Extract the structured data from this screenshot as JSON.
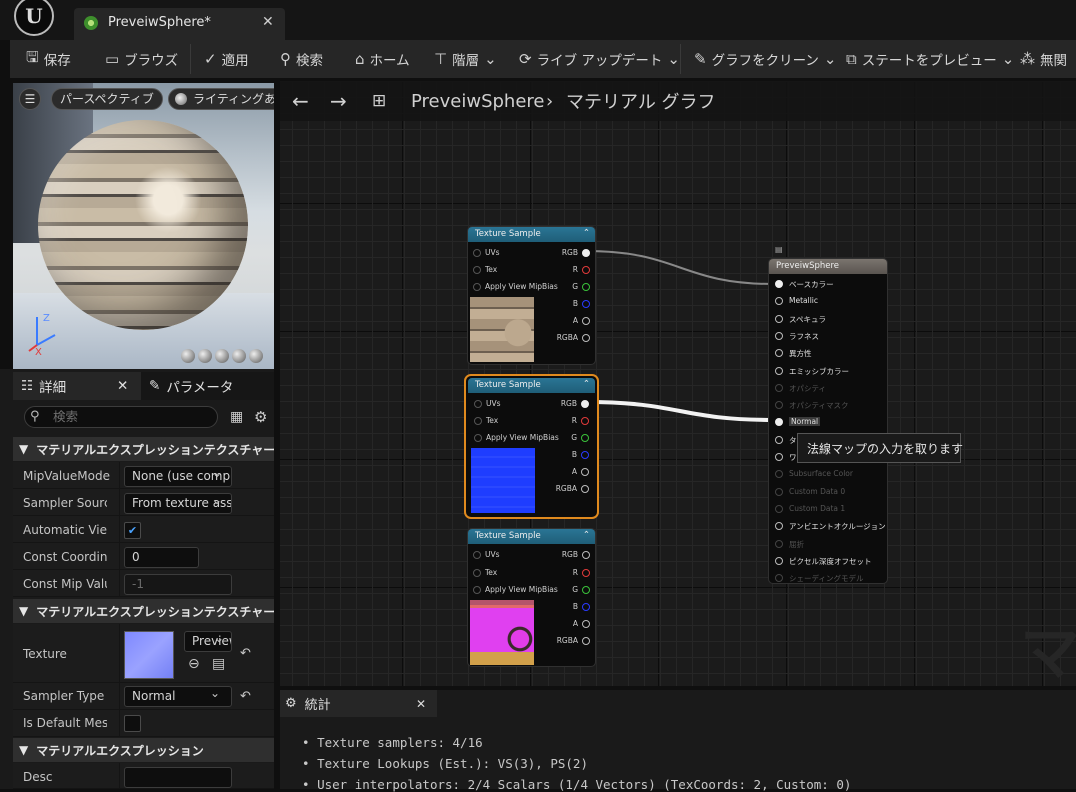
{
  "window": {
    "tab_title": "PreveiwSphere*",
    "close_glyph": "✕"
  },
  "toolbar": {
    "items": [
      {
        "icon": "save-icon",
        "label": "保存"
      },
      {
        "icon": "browse-icon",
        "label": "ブラウズ"
      },
      {
        "icon": "apply-icon",
        "label": "適用"
      },
      {
        "icon": "search-icon",
        "label": "検索"
      },
      {
        "icon": "home-icon",
        "label": "ホーム"
      },
      {
        "icon": "hierarchy-icon",
        "label": "階層"
      },
      {
        "icon": "live-update-icon",
        "label": "ライブ アップデート"
      },
      {
        "icon": "clean-graph-icon",
        "label": "グラフをクリーン"
      },
      {
        "icon": "state-preview-icon",
        "label": "ステートをプレビュー"
      },
      {
        "icon": "hide-unrelated-icon",
        "label": "無関"
      }
    ]
  },
  "viewport": {
    "perspective": "パースペクティブ",
    "lighting": "ライティングあり",
    "axis_z": "Z",
    "axis_x": "X"
  },
  "details": {
    "tabs": [
      {
        "label": "詳細"
      },
      {
        "label": "パラメータ"
      }
    ],
    "search_placeholder": "検索",
    "categories": [
      "マテリアルエクスプレッションテクスチャーサンプル",
      "マテリアルエクスプレッションテクスチャーベース",
      "マテリアルエクスプレッション"
    ],
    "rows": [
      {
        "label": "MipValueMode",
        "value": "None (use computed mip)"
      },
      {
        "label": "Sampler Source",
        "value": "From texture asset"
      },
      {
        "label": "Automatic View Mip Bias",
        "value": "✔"
      },
      {
        "label": "Const Coordinate",
        "value": "0"
      },
      {
        "label": "Const Mip Value",
        "value": "-1"
      },
      {
        "label": "Texture",
        "value": "Preview"
      },
      {
        "label": "Sampler Type",
        "value": "Normal"
      },
      {
        "label": "Is Default Meshpaint Texture",
        "value": ""
      },
      {
        "label": "Desc",
        "value": ""
      }
    ],
    "reset_glyph": "↶"
  },
  "graph": {
    "breadcrumb": {
      "root": "PreveiwSphere",
      "separator": "›",
      "current": "マテリアル グラフ"
    },
    "sample_nodes": [
      {
        "title": "Texture Sample",
        "inputs": [
          "UVs",
          "Tex",
          "Apply View MipBias"
        ],
        "outputs": [
          "RGB",
          "R",
          "G",
          "B",
          "A",
          "RGBA"
        ]
      },
      {
        "title": "Texture Sample",
        "inputs": [
          "UVs",
          "Tex",
          "Apply View MipBias"
        ],
        "outputs": [
          "RGB",
          "R",
          "G",
          "B",
          "A",
          "RGBA"
        ]
      },
      {
        "title": "Texture Sample",
        "inputs": [
          "UVs",
          "Tex",
          "Apply View MipBias"
        ],
        "outputs": [
          "RGB",
          "R",
          "G",
          "B",
          "A",
          "RGBA"
        ]
      }
    ],
    "result_node": {
      "title": "PreveiwSphere",
      "pins": [
        {
          "label": "ベースカラー",
          "enabled": true
        },
        {
          "label": "Metallic",
          "enabled": true
        },
        {
          "label": "スペキュラ",
          "enabled": true
        },
        {
          "label": "ラフネス",
          "enabled": true
        },
        {
          "label": "異方性",
          "enabled": true
        },
        {
          "label": "エミッシブカラー",
          "enabled": true
        },
        {
          "label": "オパシティ",
          "enabled": false
        },
        {
          "label": "オパシティマスク",
          "enabled": false
        },
        {
          "label": "Normal",
          "enabled": true
        },
        {
          "label": "タ",
          "enabled": true
        },
        {
          "label": "ワ",
          "enabled": true
        },
        {
          "label": "Subsurface Color",
          "enabled": false
        },
        {
          "label": "Custom Data 0",
          "enabled": false
        },
        {
          "label": "Custom Data 1",
          "enabled": false
        },
        {
          "label": "アンビエントオクルージョン",
          "enabled": true
        },
        {
          "label": "屈折",
          "enabled": false
        },
        {
          "label": "ピクセル深度オフセット",
          "enabled": true
        },
        {
          "label": "シェーディングモデル",
          "enabled": false
        }
      ]
    },
    "tooltip": "法線マップの入力を取ります",
    "watermark": "マ"
  },
  "stats": {
    "tab_label": "統計",
    "lines": [
      "Texture samplers: 4/16",
      "Texture Lookups (Est.): VS(3), PS(2)",
      "User interpolators: 2/4 Scalars (1/4 Vectors) (TexCoords: 2, Custom: 0)"
    ]
  },
  "colors": {
    "accent_orange": "#e08a1e",
    "node_header_teal": "#1f5e78",
    "result_header": "#6b6661",
    "blue_texture": "#1f3dff",
    "pink_texture": "#e040f0"
  }
}
